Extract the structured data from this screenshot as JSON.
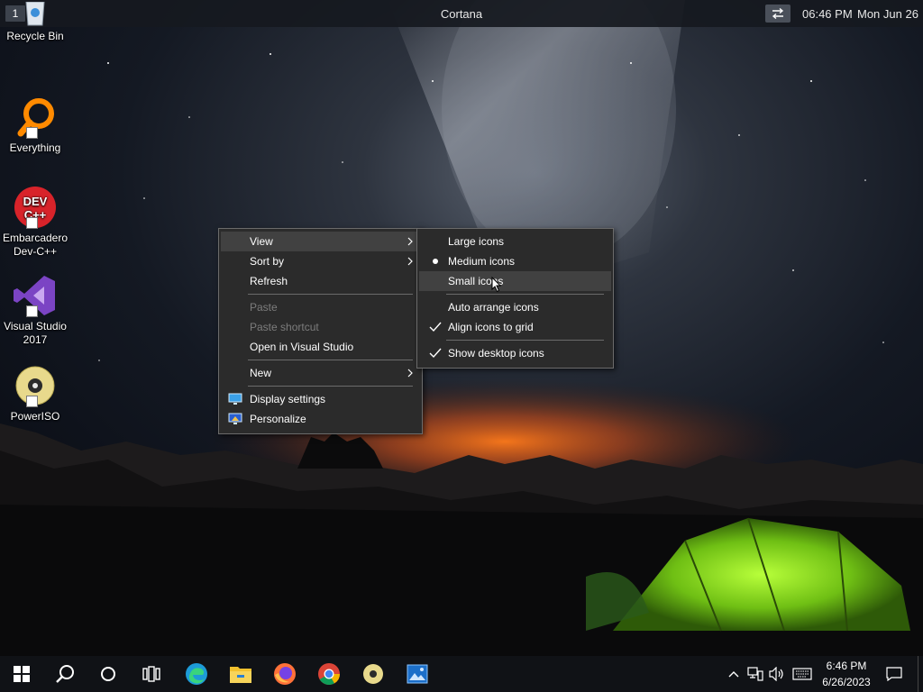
{
  "topbar": {
    "workspace": "1",
    "title": "Cortana",
    "switch_icon": "swap-arrows-icon",
    "time": "06:46 PM",
    "date": "Mon Jun 26"
  },
  "desktop_icons": [
    {
      "label": "Recycle Bin",
      "icon": "recycle-bin-icon"
    },
    {
      "label": "Everything",
      "icon": "magnifier-icon"
    },
    {
      "label": "Embarcadero Dev-C++",
      "icon": "devcpp-icon"
    },
    {
      "label": "Visual Studio 2017",
      "icon": "visual-studio-icon"
    },
    {
      "label": "PowerISO",
      "icon": "disc-icon"
    }
  ],
  "context_menu": {
    "items": [
      {
        "label": "View",
        "has_submenu": true,
        "enabled": true
      },
      {
        "label": "Sort by",
        "has_submenu": true,
        "enabled": true
      },
      {
        "label": "Refresh",
        "enabled": true
      },
      {
        "label": "Paste",
        "enabled": false
      },
      {
        "label": "Paste shortcut",
        "enabled": false
      },
      {
        "label": "Open in Visual Studio",
        "enabled": true
      },
      {
        "label": "New",
        "has_submenu": true,
        "enabled": true
      },
      {
        "label": "Display settings",
        "icon": "display-icon",
        "enabled": true
      },
      {
        "label": "Personalize",
        "icon": "personalize-icon",
        "enabled": true
      }
    ]
  },
  "view_submenu": {
    "items": [
      {
        "label": "Large icons",
        "mark": ""
      },
      {
        "label": "Medium icons",
        "mark": "bullet"
      },
      {
        "label": "Small icons",
        "mark": "",
        "hovered": true
      },
      {
        "label": "Auto arrange icons",
        "mark": ""
      },
      {
        "label": "Align icons to grid",
        "mark": "check"
      },
      {
        "label": "Show desktop icons",
        "mark": "check"
      }
    ]
  },
  "taskbar": {
    "apps": [
      "start-icon",
      "search-icon",
      "cortana-icon",
      "task-view-icon",
      "edge-icon",
      "file-explorer-icon",
      "firefox-icon",
      "chrome-icon",
      "poweriso-icon",
      "photos-icon"
    ],
    "tray": {
      "time": "6:46 PM",
      "date": "6/26/2023",
      "icons": [
        "chevron-up-icon",
        "network-icon",
        "volume-icon",
        "keyboard-icon",
        "notification-icon"
      ]
    }
  },
  "colors": {
    "menu_bg": "#2b2b2b",
    "menu_border": "#6b6b6b",
    "menu_highlight": "#414141",
    "disabled_text": "#7c7c7c",
    "taskbar_bg": "#101216",
    "tent_green": "#7dcc1f"
  }
}
